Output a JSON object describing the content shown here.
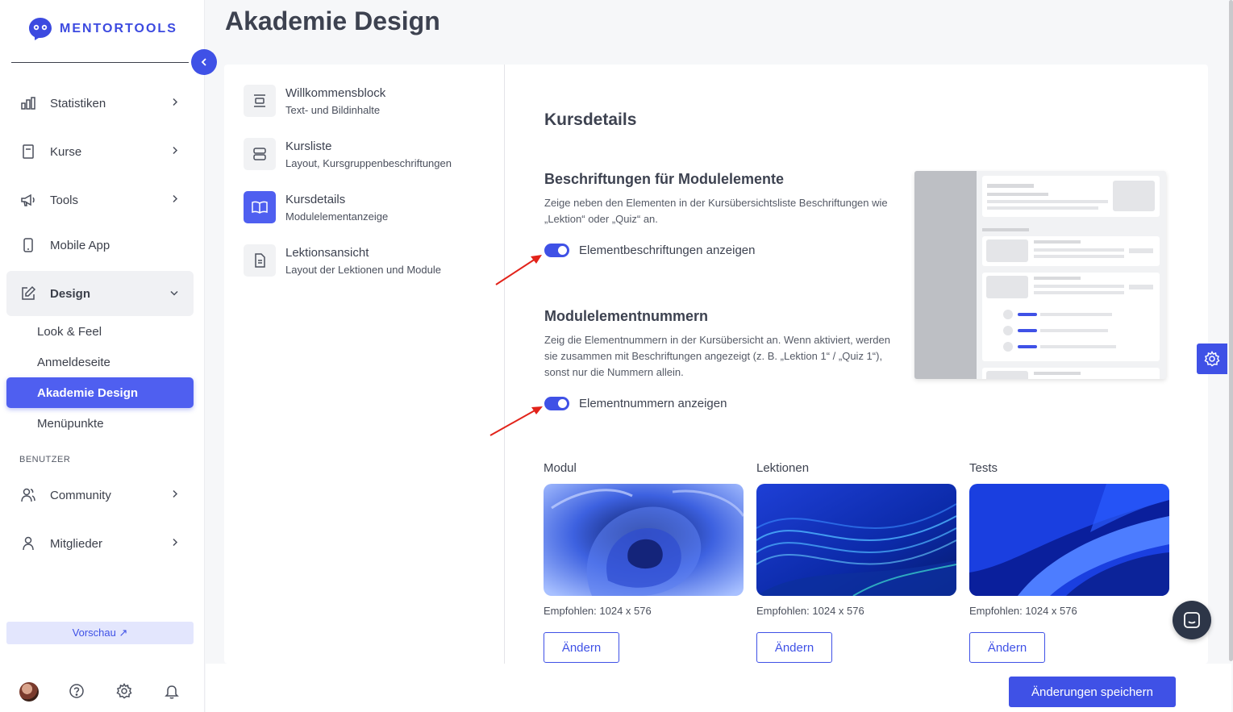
{
  "brand": {
    "name": "MENTORTOOLS",
    "accent": "#3f51e6"
  },
  "sidebar": {
    "items": [
      {
        "label": "Statistiken",
        "icon": "bar-chart-icon"
      },
      {
        "label": "Kurse",
        "icon": "book-icon"
      },
      {
        "label": "Tools",
        "icon": "megaphone-icon"
      },
      {
        "label": "Mobile App",
        "icon": "phone-icon"
      },
      {
        "label": "Design",
        "icon": "edit-icon"
      }
    ],
    "design_subitems": [
      "Look & Feel",
      "Anmeldeseite",
      "Akademie Design",
      "Menüpunkte"
    ],
    "section_label": "BENUTZER",
    "user_items": [
      {
        "label": "Community",
        "icon": "users-icon"
      },
      {
        "label": "Mitglieder",
        "icon": "user-icon"
      }
    ],
    "preview_label": "Vorschau ↗"
  },
  "page": {
    "title": "Akademie Design"
  },
  "settings_menu": [
    {
      "title": "Willkommensblock",
      "subtitle": "Text- und Bildinhalte"
    },
    {
      "title": "Kursliste",
      "subtitle": "Layout, Kursgruppenbeschriftungen"
    },
    {
      "title": "Kursdetails",
      "subtitle": "Modulelementanzeige"
    },
    {
      "title": "Lektionsansicht",
      "subtitle": "Layout der Lektionen und Module"
    }
  ],
  "details": {
    "title": "Kursdetails",
    "labels_section": {
      "heading": "Beschriftungen für Modulelemente",
      "description": "Zeige neben den Elementen in der Kursübersichtsliste Beschriftungen wie „Lektion“ oder „Quiz“ an.",
      "toggle_label": "Elementbeschriftungen anzeigen",
      "toggle_on": true
    },
    "numbers_section": {
      "heading": "Modulelementnummern",
      "description": "Zeig die Elementnummern in der Kursübersicht an. Wenn aktiviert, werden sie zusammen mit Beschriftungen angezeigt (z. B. „Lektion 1“ / „Quiz 1“), sonst nur die Nummern allein.",
      "toggle_label": "Elementnummern anzeigen",
      "toggle_on": true
    },
    "images": [
      {
        "label": "Modul",
        "hint": "Empfohlen: 1024 x 576",
        "button": "Ändern"
      },
      {
        "label": "Lektionen",
        "hint": "Empfohlen: 1024 x 576",
        "button": "Ändern"
      },
      {
        "label": "Tests",
        "hint": "Empfohlen: 1024 x 576",
        "button": "Ändern"
      }
    ]
  },
  "footer": {
    "save_label": "Änderungen speichern"
  }
}
